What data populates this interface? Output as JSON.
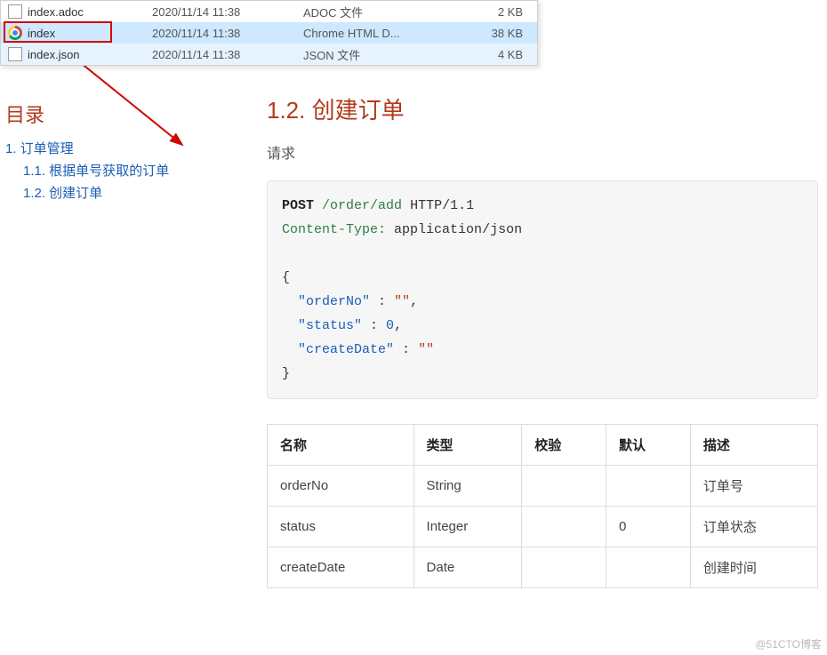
{
  "files": [
    {
      "name": "index.adoc",
      "date": "2020/11/14 11:38",
      "type": "ADOC 文件",
      "size": "2 KB",
      "icon": "adoc",
      "selected": false
    },
    {
      "name": "index",
      "date": "2020/11/14 11:38",
      "type": "Chrome HTML D...",
      "size": "38 KB",
      "icon": "chrome",
      "selected": true
    },
    {
      "name": "index.json",
      "date": "2020/11/14 11:38",
      "type": "JSON 文件",
      "size": "4 KB",
      "icon": "json",
      "selected": "alt"
    }
  ],
  "toc": {
    "title": "目录",
    "items": [
      {
        "level": 1,
        "label": "1. 订单管理"
      },
      {
        "level": 2,
        "label": "1.1. 根据单号获取的订单"
      },
      {
        "level": 2,
        "label": "1.2. 创建订单"
      }
    ]
  },
  "section": {
    "title": "1.2. 创建订单",
    "request_label": "请求",
    "http": {
      "method": "POST",
      "path": "/order/add",
      "version": "HTTP/1.1",
      "header_name": "Content-Type:",
      "header_value": "application/json",
      "body_open": "{",
      "body_k1": "\"orderNo\"",
      "body_c1": " : ",
      "body_v1": "\"\"",
      "body_k2": "\"status\"",
      "body_c2": " : ",
      "body_v2": "0",
      "body_k3": "\"createDate\"",
      "body_c3": " : ",
      "body_v3": "\"\"",
      "body_close": "}",
      "comma": ","
    },
    "table": {
      "headers": {
        "name": "名称",
        "type": "类型",
        "validate": "校验",
        "default": "默认",
        "desc": "描述"
      },
      "rows": [
        {
          "name": "orderNo",
          "type": "String",
          "validate": "",
          "default": "",
          "desc": "订单号"
        },
        {
          "name": "status",
          "type": "Integer",
          "validate": "",
          "default": "0",
          "desc": "订单状态"
        },
        {
          "name": "createDate",
          "type": "Date",
          "validate": "",
          "default": "",
          "desc": "创建时间"
        }
      ]
    }
  },
  "watermark": "@51CTO博客"
}
